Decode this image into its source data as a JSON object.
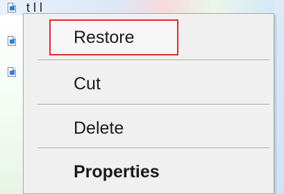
{
  "window": {
    "partial_title": "t    l l"
  },
  "menu": {
    "items": [
      {
        "label": "Restore",
        "highlighted": true,
        "bold": false
      },
      {
        "label": "Cut",
        "highlighted": false,
        "bold": false
      },
      {
        "label": "Delete",
        "highlighted": false,
        "bold": false
      },
      {
        "label": "Properties",
        "highlighted": false,
        "bold": true
      }
    ]
  },
  "colors": {
    "menu_background": "#f0f0f0",
    "highlight_border": "#e0262b",
    "separator": "#a0a0a0",
    "text": "#1a1a1a"
  }
}
